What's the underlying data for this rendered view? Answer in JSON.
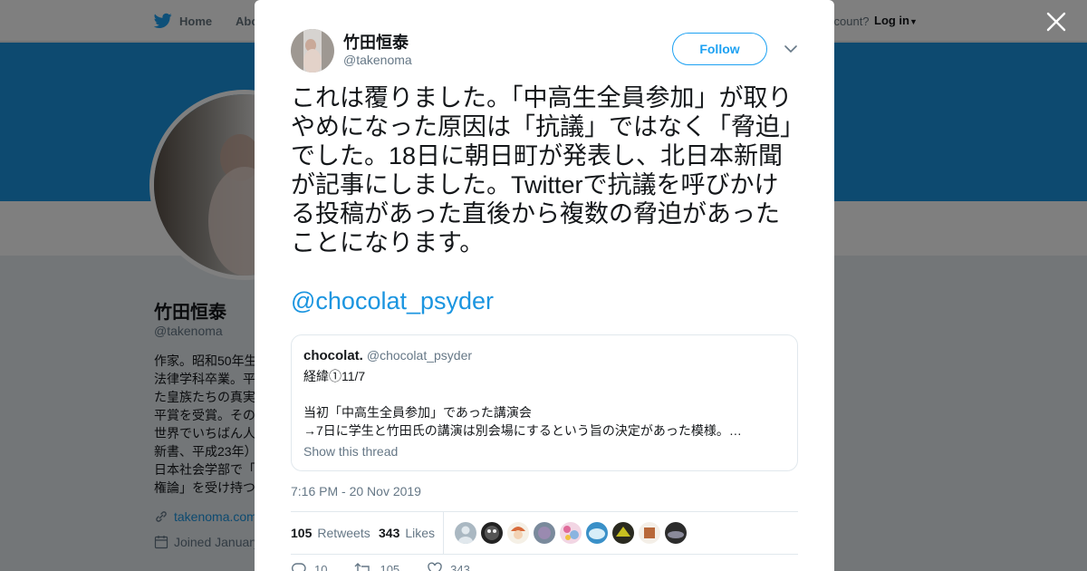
{
  "nav": {
    "home_label": "Home",
    "about_label": "Abo",
    "account_prompt": "ccount?",
    "login_label": "Log in"
  },
  "profile": {
    "name": "竹田恒泰",
    "handle": "@takenoma",
    "bio_lines": [
      "作家。昭和50年生",
      "法律学科卒業。平",
      "た皇族たちの真実",
      "平賞を受賞。その",
      "世界でいちばん人",
      "新書、平成23年）",
      "日本社会学部で「",
      "権論」を受け持つ"
    ],
    "link_text": "takenoma.com",
    "joined_text": "Joined January"
  },
  "tweet": {
    "author_name": "竹田恒泰",
    "author_handle": "@takenoma",
    "follow_label": "Follow",
    "text": "これは覆りました。「中高生全員参加」が取りやめになった原因は「抗議」ではなく「脅迫」でした。18日に朝日町が発表し、北日本新聞が記事にしました。Twitterで抗議を呼びかける投稿があった直後から複数の脅迫があったことになります。",
    "mention": "@chocolat_psyder",
    "quote": {
      "name": "chocolat.",
      "handle": "@chocolat_psyder",
      "line1": "経緯①11/7",
      "line2": "当初「中高生全員参加」であった講演会",
      "line3": "→7日に学生と竹田氏の講演は別会場にするという旨の決定があった模様。…",
      "show_thread": "Show this thread"
    },
    "timestamp": "7:16 PM - 20 Nov 2019",
    "retweets_count": "105",
    "retweets_label": "Retweets",
    "likes_count": "343",
    "likes_label": "Likes",
    "actions": {
      "reply_count": "10",
      "retweet_count": "105",
      "like_count": "343"
    }
  },
  "colors": {
    "brand_blue": "#1da1f2",
    "banner": "#1b95e0",
    "text": "#14171a",
    "muted": "#657786"
  },
  "icons": [
    "twitter-bird-icon",
    "close-icon",
    "chevron-down-icon",
    "link-icon",
    "calendar-icon",
    "reply-icon",
    "retweet-icon",
    "heart-icon"
  ]
}
